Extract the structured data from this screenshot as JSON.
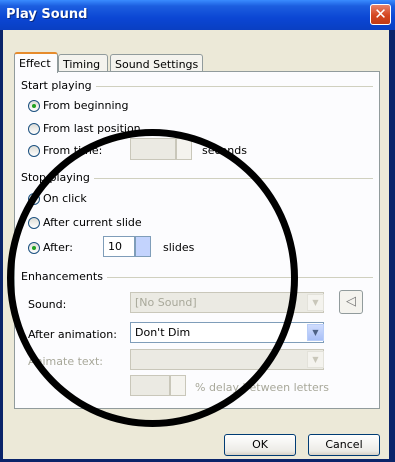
{
  "window": {
    "title": "Play Sound",
    "close_glyph": "✕"
  },
  "tabs": [
    {
      "label": "Effect",
      "active": true
    },
    {
      "label": "Timing",
      "active": false
    },
    {
      "label": "Sound Settings",
      "active": false
    }
  ],
  "start_playing": {
    "heading": "Start playing",
    "options": [
      {
        "label": "From beginning",
        "selected": true
      },
      {
        "label": "From last position",
        "selected": false
      },
      {
        "label": "From time:",
        "selected": false
      }
    ],
    "time_value": "",
    "time_unit": "seconds"
  },
  "stop_playing": {
    "heading": "Stop playing",
    "options": [
      {
        "label": "On click",
        "selected": false
      },
      {
        "label": "After current slide",
        "selected": false
      },
      {
        "label": "After:",
        "selected": true
      }
    ],
    "after_value": "10",
    "after_unit": "slides"
  },
  "enhancements": {
    "heading": "Enhancements",
    "sound_label": "Sound:",
    "sound_value": "[No Sound]",
    "speaker_icon": "speaker-icon",
    "after_animation_label": "After animation:",
    "after_animation_value": "Don't Dim",
    "animate_text_label": "Animate text:",
    "animate_text_value": "",
    "delay_value": "",
    "delay_unit": "% delay between letters"
  },
  "buttons": {
    "ok": "OK",
    "cancel": "Cancel"
  },
  "annotation": {
    "shape": "circle",
    "color": "#000000"
  }
}
